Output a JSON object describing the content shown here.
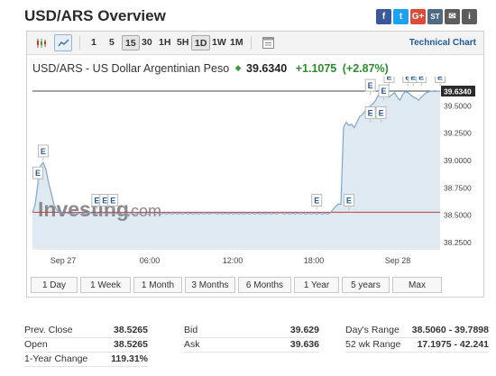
{
  "title": "USD/ARS Overview",
  "share": [
    {
      "name": "facebook-icon",
      "glyph": "f"
    },
    {
      "name": "twitter-icon",
      "glyph": "t"
    },
    {
      "name": "google-plus-icon",
      "glyph": "G+"
    },
    {
      "name": "stocktwits-icon",
      "glyph": "ST"
    },
    {
      "name": "mail-icon",
      "glyph": "✉"
    },
    {
      "name": "print-icon",
      "glyph": "i"
    }
  ],
  "toolbar": {
    "timeframes": [
      "1",
      "5",
      "15",
      "30",
      "1H",
      "5H",
      "1D",
      "1W",
      "1M"
    ],
    "selected_timeframe": "15",
    "technical_chart": "Technical Chart"
  },
  "header": {
    "pair_name": "USD/ARS - US Dollar Argentinian Peso",
    "price": "39.6340",
    "change": "+1.1075",
    "change_pct": "(+2.87%)"
  },
  "watermark": {
    "main": "Investing",
    "suffix": ".com"
  },
  "ranges": [
    "1 Day",
    "1 Week",
    "1 Month",
    "3 Months",
    "6 Months",
    "1 Year",
    "5 years",
    "Max"
  ],
  "stats": {
    "prev_close": {
      "label": "Prev. Close",
      "value": "38.5265"
    },
    "open": {
      "label": "Open",
      "value": "38.5265"
    },
    "one_year_change": {
      "label": "1-Year Change",
      "value": "119.31%"
    },
    "bid": {
      "label": "Bid",
      "value": "39.629"
    },
    "ask": {
      "label": "Ask",
      "value": "39.636"
    },
    "days_range": {
      "label": "Day's Range",
      "value": "38.5060 - 39.7898"
    },
    "wk52_range": {
      "label": "52 wk Range",
      "value": "17.1975 - 42.241"
    }
  },
  "chart_data": {
    "type": "area",
    "x_tick_labels": [
      "Sep 27",
      "06:00",
      "12:00",
      "18:00",
      "Sep 28"
    ],
    "y_tick_labels": [
      "39.5000",
      "39.2500",
      "39.0000",
      "38.7500",
      "38.5000",
      "38.2500"
    ],
    "y_ticks": [
      39.5,
      39.25,
      39.0,
      38.75,
      38.5,
      38.25
    ],
    "ylim": [
      38.2,
      39.7
    ],
    "current_price_label": "39.6340",
    "current_price": 39.634,
    "prev_close": 38.5265,
    "series": [
      {
        "x": [
          0,
          3,
          6,
          9,
          12,
          15,
          18,
          21,
          24,
          27,
          30,
          33,
          36,
          39,
          42,
          45,
          48,
          51,
          54,
          57,
          60,
          63,
          66,
          69,
          72,
          75,
          78,
          81,
          84,
          87,
          90,
          93,
          96,
          99,
          102,
          105,
          108,
          111,
          114,
          117,
          120,
          123,
          126,
          129,
          132,
          135,
          138,
          141,
          144,
          147,
          150,
          153,
          156,
          159,
          162,
          165,
          168,
          171,
          174,
          177,
          180,
          183,
          186,
          189,
          192,
          195,
          198,
          201,
          204,
          207,
          210,
          213,
          216,
          219,
          222,
          225,
          228,
          231,
          234,
          237,
          240,
          243,
          246,
          249,
          252,
          255,
          258,
          261,
          264,
          267,
          270,
          273,
          276,
          279,
          282,
          285,
          288,
          291,
          294,
          297,
          300,
          303,
          306,
          309,
          312,
          315,
          318,
          321,
          324,
          327,
          330,
          333,
          336,
          339,
          342,
          345,
          348,
          351,
          354,
          357,
          360,
          363,
          366,
          369,
          372,
          375,
          378,
          381,
          384,
          387,
          390,
          393,
          396,
          399,
          402,
          405,
          408,
          411,
          414,
          417,
          420,
          423,
          426,
          429,
          432,
          435,
          438,
          441,
          444,
          447,
          450,
          453,
          456
        ],
        "y": [
          38.52,
          38.6,
          38.78,
          38.95,
          38.98,
          38.92,
          38.8,
          38.7,
          38.6,
          38.55,
          38.53,
          38.52,
          38.52,
          38.52,
          38.51,
          38.52,
          38.51,
          38.52,
          38.51,
          38.52,
          38.51,
          38.53,
          38.52,
          38.51,
          38.52,
          38.51,
          38.52,
          38.52,
          38.51,
          38.52,
          38.51,
          38.52,
          38.51,
          38.52,
          38.51,
          38.52,
          38.51,
          38.52,
          38.51,
          38.52,
          38.51,
          38.52,
          38.52,
          38.51,
          38.52,
          38.52,
          38.51,
          38.52,
          38.51,
          38.52,
          38.51,
          38.52,
          38.51,
          38.52,
          38.51,
          38.52,
          38.51,
          38.52,
          38.51,
          38.52,
          38.51,
          38.52,
          38.51,
          38.52,
          38.51,
          38.52,
          38.51,
          38.52,
          38.52,
          38.51,
          38.52,
          38.51,
          38.52,
          38.51,
          38.52,
          38.51,
          38.52,
          38.51,
          38.52,
          38.51,
          38.52,
          38.51,
          38.52,
          38.51,
          38.52,
          38.51,
          38.52,
          38.51,
          38.52,
          38.51,
          38.52,
          38.51,
          38.52,
          38.52,
          38.51,
          38.52,
          38.51,
          38.52,
          38.51,
          38.52,
          38.51,
          38.52,
          38.51,
          38.52,
          38.51,
          38.52,
          38.51,
          38.52,
          38.51,
          38.52,
          38.51,
          38.52,
          38.55,
          38.58,
          38.6,
          38.6,
          39.3,
          39.35,
          39.32,
          39.33,
          39.3,
          39.35,
          39.4,
          39.42,
          39.45,
          39.48,
          39.5,
          39.52,
          39.55,
          39.6,
          39.63,
          39.65,
          39.6,
          39.58,
          39.6,
          39.62,
          39.58,
          39.55,
          39.6,
          39.63,
          39.62,
          39.6,
          39.58,
          39.57,
          39.55,
          39.58,
          39.6,
          39.62,
          39.63,
          39.634,
          39.63,
          39.634,
          39.634
        ]
      }
    ],
    "event_markers": [
      {
        "label": "E",
        "x": 12,
        "y": 39.0
      },
      {
        "label": "E",
        "x": 6,
        "y": 38.8
      },
      {
        "label": "E",
        "x": 72,
        "y": 38.55
      },
      {
        "label": "E",
        "x": 81,
        "y": 38.55
      },
      {
        "label": "E",
        "x": 90,
        "y": 38.55
      },
      {
        "label": "E",
        "x": 318,
        "y": 38.55
      },
      {
        "label": "E",
        "x": 354,
        "y": 38.55
      },
      {
        "label": "E",
        "x": 378,
        "y": 39.6
      },
      {
        "label": "E",
        "x": 378,
        "y": 39.35
      },
      {
        "label": "E",
        "x": 390,
        "y": 39.35
      },
      {
        "label": "E",
        "x": 393,
        "y": 39.55
      },
      {
        "label": "E",
        "x": 399,
        "y": 39.68
      },
      {
        "label": "E",
        "x": 420,
        "y": 39.68
      },
      {
        "label": "E",
        "x": 426,
        "y": 39.68
      },
      {
        "label": "E",
        "x": 435,
        "y": 39.68
      },
      {
        "label": "E",
        "x": 456,
        "y": 39.68
      }
    ]
  }
}
